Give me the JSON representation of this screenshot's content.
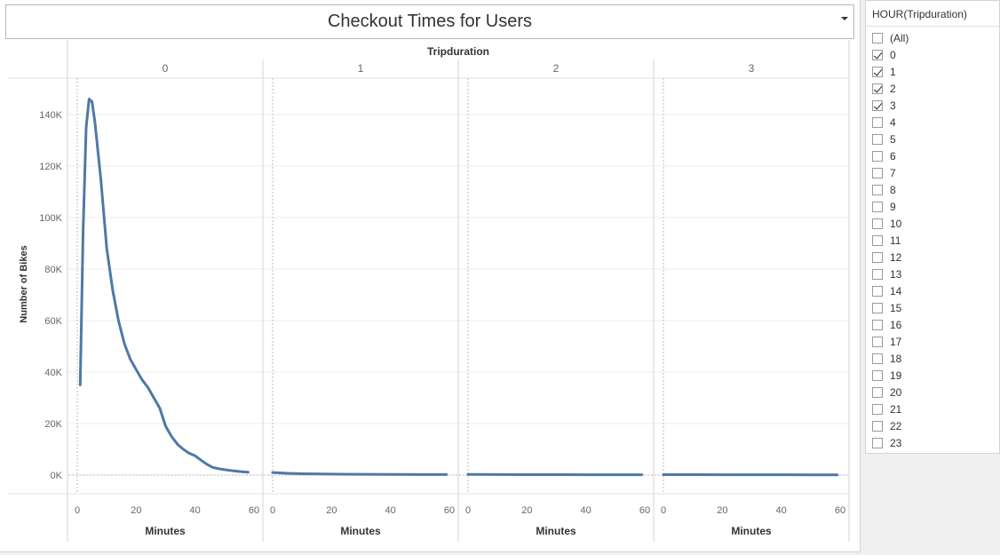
{
  "title": "Checkout Times for Users",
  "filter": {
    "title": "HOUR(Tripduration)",
    "items": [
      {
        "label": "(All)",
        "checked": false
      },
      {
        "label": "0",
        "checked": true
      },
      {
        "label": "1",
        "checked": true
      },
      {
        "label": "2",
        "checked": true
      },
      {
        "label": "3",
        "checked": true
      },
      {
        "label": "4",
        "checked": false
      },
      {
        "label": "5",
        "checked": false
      },
      {
        "label": "6",
        "checked": false
      },
      {
        "label": "7",
        "checked": false
      },
      {
        "label": "8",
        "checked": false
      },
      {
        "label": "9",
        "checked": false
      },
      {
        "label": "10",
        "checked": false
      },
      {
        "label": "11",
        "checked": false
      },
      {
        "label": "12",
        "checked": false
      },
      {
        "label": "13",
        "checked": false
      },
      {
        "label": "14",
        "checked": false
      },
      {
        "label": "15",
        "checked": false
      },
      {
        "label": "16",
        "checked": false
      },
      {
        "label": "17",
        "checked": false
      },
      {
        "label": "18",
        "checked": false
      },
      {
        "label": "19",
        "checked": false
      },
      {
        "label": "20",
        "checked": false
      },
      {
        "label": "21",
        "checked": false
      },
      {
        "label": "22",
        "checked": false
      },
      {
        "label": "23",
        "checked": false
      }
    ]
  },
  "chart_data": {
    "type": "line",
    "column_header": "Tripduration",
    "xlabel": "Minutes",
    "ylabel": "Number of Bikes",
    "xlim": [
      0,
      60
    ],
    "ylim": [
      0,
      150000
    ],
    "x_ticks": [
      0,
      20,
      40,
      60
    ],
    "y_ticks": [
      0,
      20000,
      40000,
      60000,
      80000,
      100000,
      120000,
      140000
    ],
    "y_tick_labels": [
      "0K",
      "20K",
      "40K",
      "60K",
      "80K",
      "100K",
      "120K",
      "140K"
    ],
    "grid": true,
    "line_color": "#4e79a7",
    "panels": [
      {
        "header": "0",
        "x": [
          1,
          2,
          3,
          4,
          5,
          6,
          7,
          8,
          10,
          12,
          14,
          16,
          18,
          20,
          22,
          24,
          26,
          28,
          30,
          32,
          34,
          36,
          38,
          40,
          42,
          44,
          46,
          48,
          50,
          52,
          54,
          56,
          58
        ],
        "y": [
          35000,
          95000,
          135000,
          146000,
          145000,
          137000,
          126000,
          115000,
          88000,
          72000,
          60000,
          51000,
          45000,
          41000,
          37000,
          34000,
          30000,
          26000,
          19000,
          15000,
          12000,
          10000,
          8500,
          7500,
          5800,
          4200,
          3000,
          2500,
          2100,
          1800,
          1500,
          1300,
          1100
        ]
      },
      {
        "header": "1",
        "x": [
          0,
          5,
          10,
          20,
          30,
          40,
          50,
          59
        ],
        "y": [
          1000,
          700,
          500,
          380,
          300,
          250,
          220,
          200
        ]
      },
      {
        "header": "2",
        "x": [
          0,
          10,
          20,
          30,
          40,
          50,
          59
        ],
        "y": [
          250,
          200,
          180,
          160,
          150,
          140,
          130
        ]
      },
      {
        "header": "3",
        "x": [
          0,
          10,
          20,
          30,
          40,
          50,
          59
        ],
        "y": [
          180,
          160,
          150,
          140,
          130,
          120,
          110
        ]
      }
    ]
  }
}
